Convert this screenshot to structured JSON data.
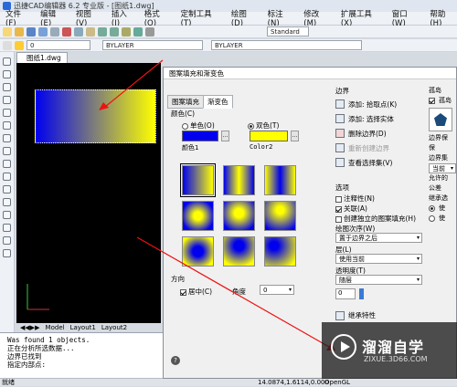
{
  "window": {
    "title": "迅捷CAD编辑器 6.2 专业版 - [图纸1.dwg]"
  },
  "menu": [
    "文件(F)",
    "编辑(E)",
    "视图(V)",
    "插入(I)",
    "格式(O)",
    "定制工具(T)",
    "绘图(D)",
    "标注(N)",
    "修改(M)",
    "扩展工具(X)",
    "窗口(W)",
    "帮助(H)"
  ],
  "toolbar2": {
    "layer": "0",
    "linetype1": "BYLAYER",
    "linetype2": "BYLAYER",
    "style": "Standard"
  },
  "document": {
    "tab": "图纸1.dwg"
  },
  "layout_tabs": [
    "Model",
    "Layout1",
    "Layout2"
  ],
  "command_lines": [
    "Was found 1 objects.",
    "正在分析所选数据...",
    "边界已找到",
    "指定内部点:"
  ],
  "status": {
    "label": "就绪",
    "coords": "14.0874,1.6114,0.000",
    "opengl": "OpenGL"
  },
  "dialog": {
    "title": "图案填充和渐变色",
    "tabs": [
      "图案填充",
      "渐变色"
    ],
    "color_group": "颜色(C)",
    "radio_single": "单色(O)",
    "radio_double": "双色(T)",
    "color1_label": "颜色1",
    "color2_label": "Color2",
    "color1": "#0000ee",
    "color2": "#ffff00",
    "direction_group": "方向",
    "center_label": "居中(C)",
    "angle_label": "角度",
    "angle_value": "0",
    "boundary_group": "边界",
    "btn_pick": "添加: 拾取点(K)",
    "btn_select": "添加: 选择实体",
    "btn_remove": "删除边界(D)",
    "btn_recreate": "重新创建边界",
    "btn_view": "查看选择集(V)",
    "options_group": "选项",
    "opt_annotative": "注释性(N)",
    "opt_associative": "关联(A)",
    "opt_separate": "创建独立的图案填充(H)",
    "draw_order_label": "绘图次序(W)",
    "draw_order_value": "置于边界之后",
    "layer_label": "层(L)",
    "layer_value": "使用当前",
    "transparency_label": "透明度(T)",
    "transparency_value": "随层",
    "transparency_num": "0",
    "inherit_label": "继承特性",
    "far_lines": [
      "孤岛",
      "孤岛",
      "",
      "",
      "边界保",
      "保",
      "边界集",
      "当前",
      "",
      "允许的",
      "公差",
      "",
      "继承选",
      "使",
      "使"
    ]
  },
  "watermark": {
    "brand": "溜溜自学",
    "site": "ZIXUE.3D66.COM"
  }
}
